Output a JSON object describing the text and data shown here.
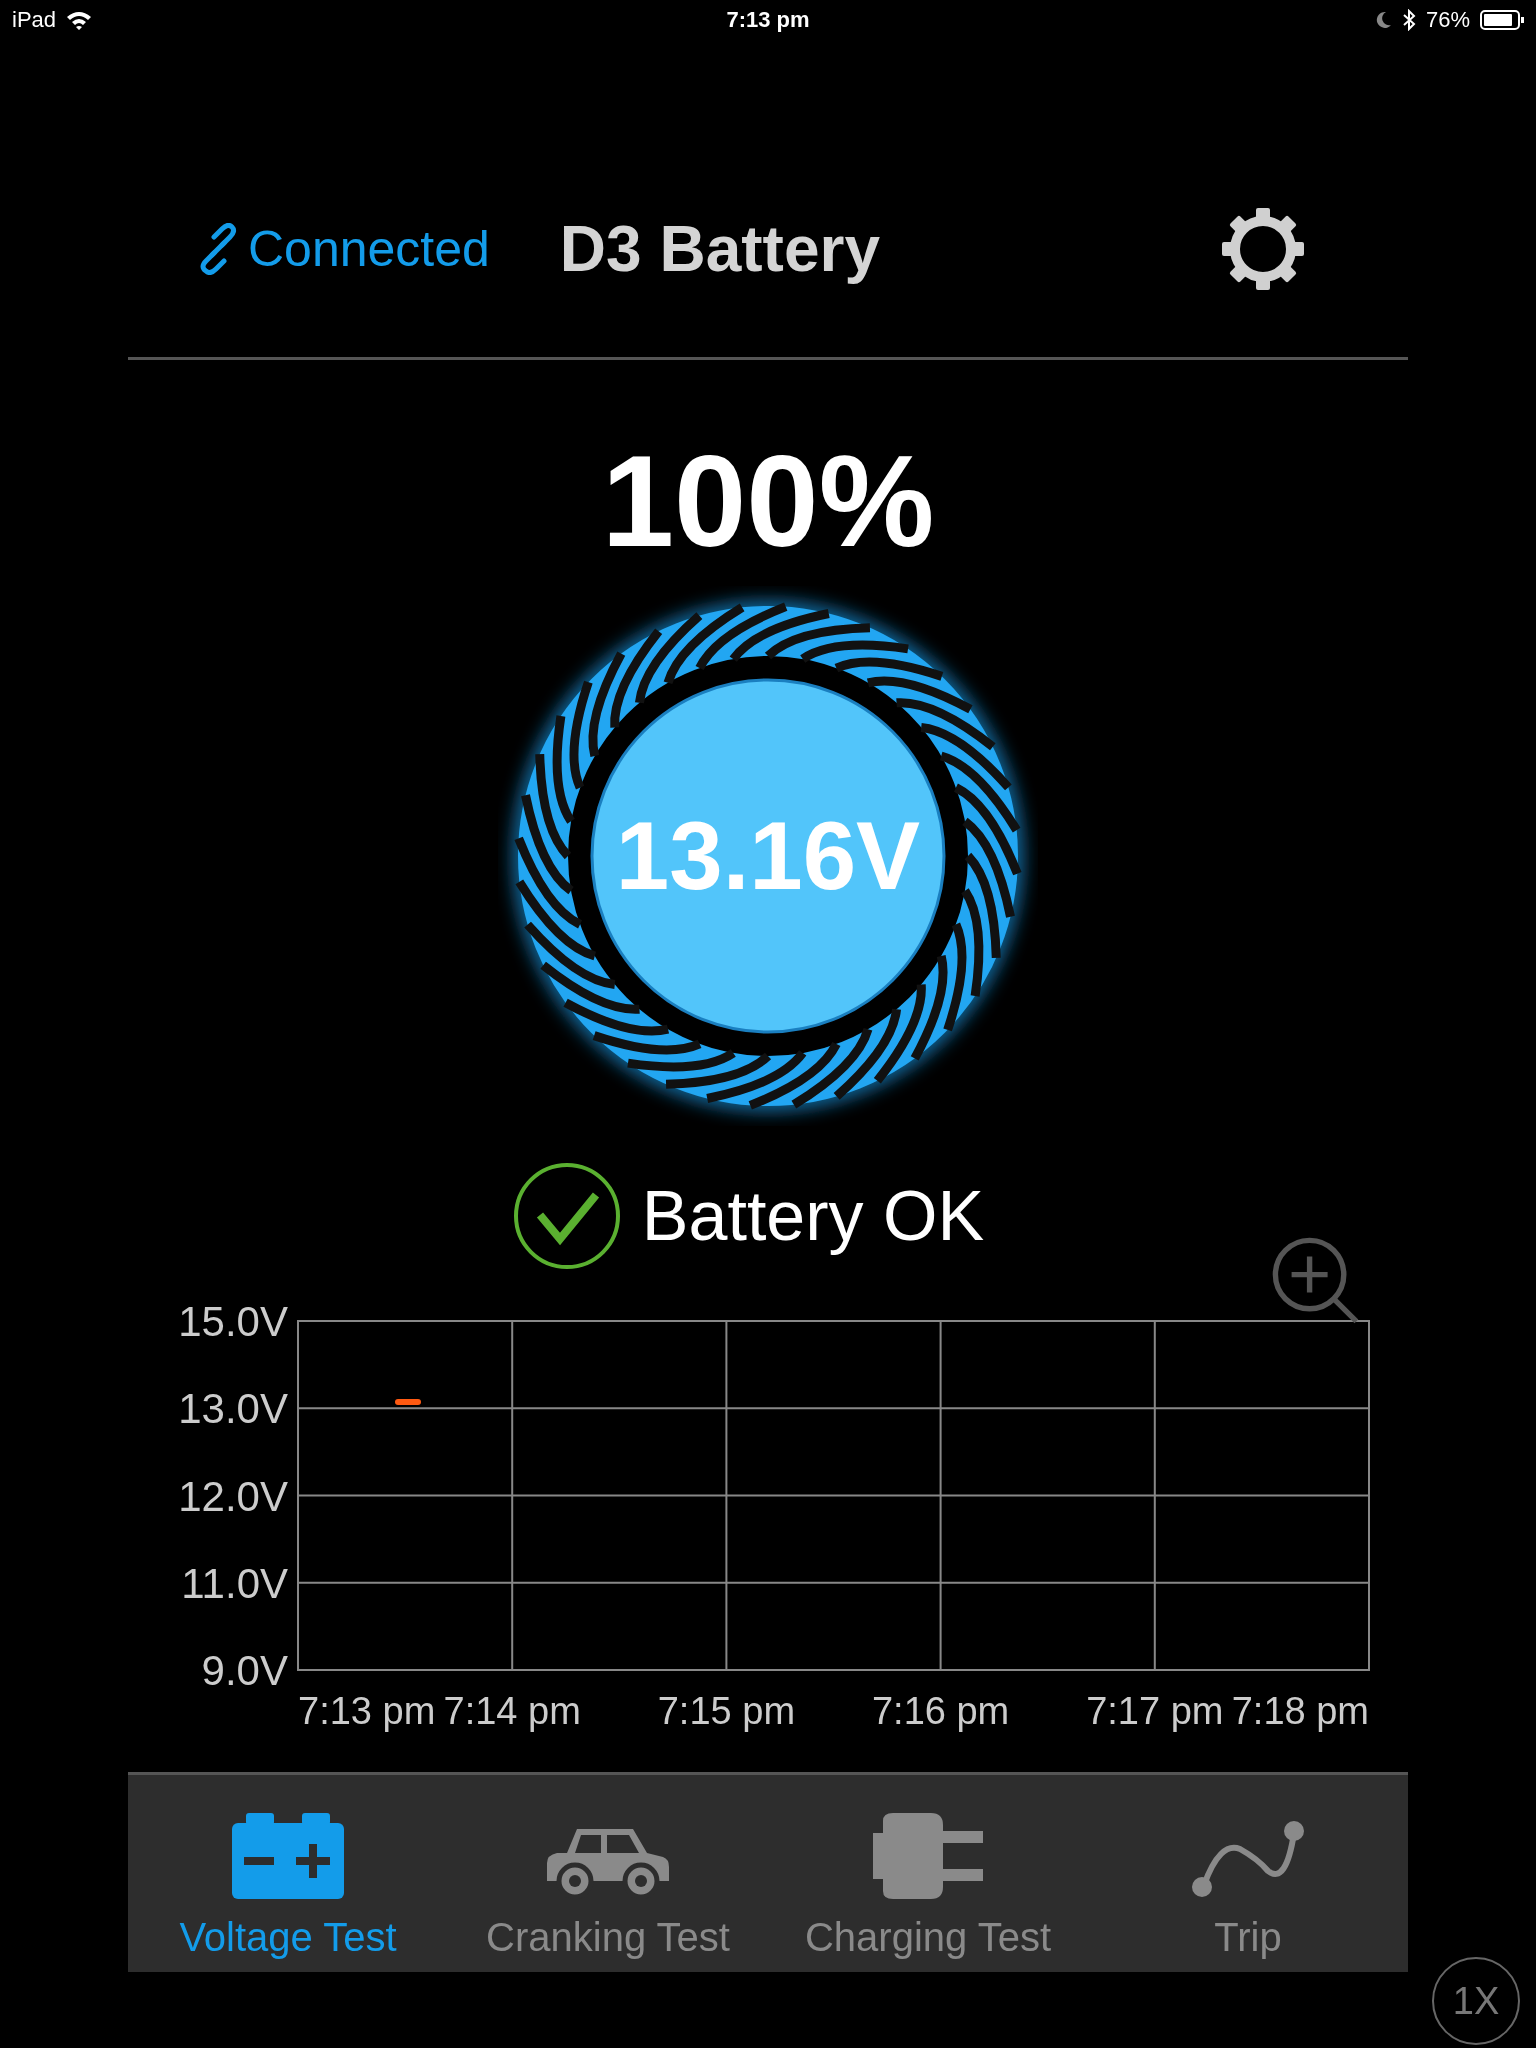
{
  "status_bar": {
    "device": "iPad",
    "time": "7:13 pm",
    "battery": "76%"
  },
  "header": {
    "connection": "Connected",
    "title": "D3 Battery"
  },
  "charge": "100%",
  "voltage": "13.16V",
  "status": {
    "label": "Battery OK",
    "ok": true
  },
  "chart": {
    "y_labels": [
      "15.0V",
      "13.0V",
      "12.0V",
      "11.0V",
      "9.0V"
    ],
    "x_labels": [
      "7:13 pm",
      "7:14 pm",
      "7:15 pm",
      "7:16 pm",
      "7:17 pm",
      "7:18 pm"
    ]
  },
  "tabs": [
    {
      "label": "Voltage Test",
      "kind": "battery",
      "selected": true
    },
    {
      "label": "Cranking Test",
      "kind": "car",
      "selected": false
    },
    {
      "label": "Charging Test",
      "kind": "plug",
      "selected": false
    },
    {
      "label": "Trip",
      "kind": "trip",
      "selected": false
    }
  ],
  "speed_badge": "1X"
}
